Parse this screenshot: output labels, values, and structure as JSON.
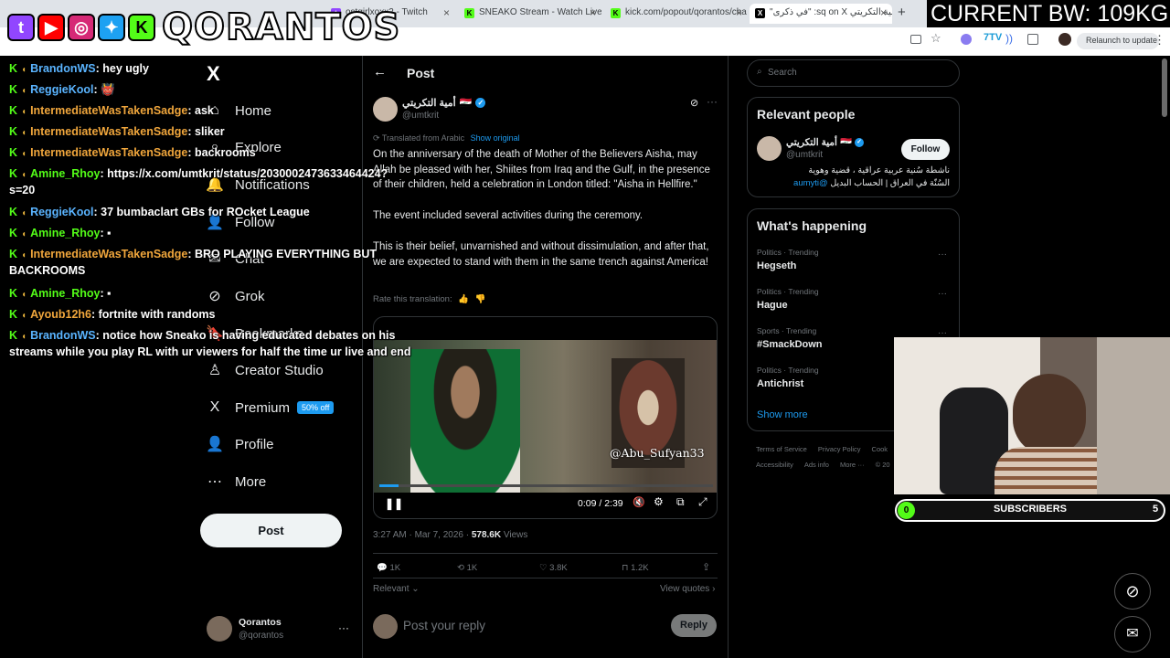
{
  "browser": {
    "tabs": [
      {
        "label": "ostgirlxoxx2 - Twitch"
      },
      {
        "label": "SNEAKO Stream - Watch Live o"
      },
      {
        "label": "kick.com/popout/qorantos/cha"
      },
      {
        "label": "\"في ذكرى\" :sq on X أمية التكريتي"
      }
    ],
    "new_tab": "+",
    "relaunch": "Relaunch to update"
  },
  "overlay": {
    "logo_text": "QORANTOS",
    "bw_text": "CURRENT BW: 109KG",
    "subs_label": "SUBSCRIBERS",
    "subs_current": "0",
    "subs_goal": "5"
  },
  "chat": [
    {
      "user": "BrandonWS",
      "color": "#5ab4ff",
      "msg": ": hey ugly"
    },
    {
      "user": "ReggieKool",
      "color": "#5ab4ff",
      "msg": ": 👹"
    },
    {
      "user": "IntermediateWasTakenSadge",
      "color": "#f0a63c",
      "msg": ": ask"
    },
    {
      "user": "IntermediateWasTakenSadge",
      "color": "#f0a63c",
      "msg": ": sliker"
    },
    {
      "user": "IntermediateWasTakenSadge",
      "color": "#f0a63c",
      "msg": ": backrooms"
    },
    {
      "user": "Amine_Rhoy",
      "color": "#53fc18",
      "msg": ": https://x.com/umtkrit/status/2030002473633464424?",
      "cont": "s=20"
    },
    {
      "user": "ReggieKool",
      "color": "#5ab4ff",
      "msg": ": 37 bumbaclart GBs for ROcket League"
    },
    {
      "user": "Amine_Rhoy",
      "color": "#53fc18",
      "msg": ": ▪"
    },
    {
      "user": "IntermediateWasTakenSadge",
      "color": "#f0a63c",
      "msg": ": BRO PLAYING EVERYTHING BUT",
      "cont": "BACKROOMS"
    },
    {
      "user": "Amine_Rhoy",
      "color": "#53fc18",
      "msg": ": ▪"
    },
    {
      "user": "Ayoub12h6",
      "color": "#f0a63c",
      "msg": ": fortnite with randoms"
    },
    {
      "user": "BrandonWS",
      "color": "#5ab4ff",
      "msg": ": notice how Sneako is having educated debates on his",
      "cont": "streams while you play RL with ur viewers for half the time ur live and end"
    }
  ],
  "nav": {
    "logo": "X",
    "items": [
      {
        "label": "Home",
        "icon": "home-icon",
        "glyph": "⌂"
      },
      {
        "label": "Explore",
        "icon": "search-icon",
        "glyph": "⌕"
      },
      {
        "label": "Notifications",
        "icon": "bell-icon",
        "glyph": "🔔"
      },
      {
        "label": "Follow",
        "icon": "follow-icon",
        "glyph": "👤"
      },
      {
        "label": "Chat",
        "icon": "chat-icon",
        "glyph": "✉"
      },
      {
        "label": "Grok",
        "icon": "grok-icon",
        "glyph": "⊘"
      },
      {
        "label": "Bookmarks",
        "icon": "bookmark-icon",
        "glyph": "🔖"
      },
      {
        "label": "Creator Studio",
        "icon": "creator-studio-icon",
        "glyph": "♙"
      },
      {
        "label": "Premium",
        "icon": "premium-icon",
        "glyph": "X",
        "badge": "50% off"
      },
      {
        "label": "Profile",
        "icon": "profile-icon",
        "glyph": "👤"
      },
      {
        "label": "More",
        "icon": "more-icon",
        "glyph": "⋯"
      }
    ],
    "post_button": "Post",
    "account_name": "Qorantos",
    "account_handle": "@qorantos",
    "account_more": "···"
  },
  "post": {
    "header_title": "Post",
    "author_name": "أمية التكريتي",
    "author_flag": "🇮🇶",
    "author_handle": "@umtkrit",
    "translated_label": "Translated from Arabic",
    "show_original": "Show original",
    "paragraphs": [
      "On the anniversary of the death of Mother of the Believers Aisha, may Allah be pleased with her, Shiites from Iraq and the Gulf, in the presence of their children, held a celebration in London titled: \"Aisha in Hellfire.\"",
      "The event included several activities during the ceremony.",
      "This is their belief, unvarnished and without dissimulation, and after that, we are expected to stand with them in the same trench against America!"
    ],
    "rate_translation": "Rate this translation:",
    "video_watermark": "@Abu_Sufyan33",
    "video_time": "0:09 / 2:39",
    "video_progress": 0.057,
    "timestamp": "3:27 AM · Mar 7, 2026 · ",
    "views_count": "578.6K",
    "views_label": " Views",
    "stats": {
      "replies": "1K",
      "reposts": "1K",
      "likes": "3.8K",
      "bookmarks": "1.2K"
    },
    "sort_label": "Relevant",
    "view_quotes": "View quotes",
    "reply_placeholder": "Post your reply",
    "reply_button": "Reply"
  },
  "sidebar": {
    "search_placeholder": "Search",
    "relevant_title": "Relevant people",
    "person_name": "أمية التكريتي",
    "person_flag": "🇮🇶",
    "person_handle": "@umtkrit",
    "follow_label": "Follow",
    "bio_line1": "ناشطة سُنية عربية عراقية ، قضية وهوية",
    "bio_mention": "@aumyti",
    "bio_line2": "السُنّة في العراق | الحساب البديل",
    "happening_title": "What's happening",
    "trends": [
      {
        "category": "Politics · Trending",
        "name": "Hegseth"
      },
      {
        "category": "Politics · Trending",
        "name": "Hague"
      },
      {
        "category": "Sports · Trending",
        "name": "#SmackDown"
      },
      {
        "category": "Politics · Trending",
        "name": "Antichrist"
      }
    ],
    "show_more": "Show more",
    "footer1": [
      "Terms of Service",
      "Privacy Policy",
      "Cook"
    ],
    "footer2": [
      "Accessibility",
      "Ads info",
      "More ···",
      "© 20"
    ]
  },
  "colors": {
    "accent": "#1d9bf0",
    "kick": "#53fc18",
    "bg": "#000000"
  }
}
